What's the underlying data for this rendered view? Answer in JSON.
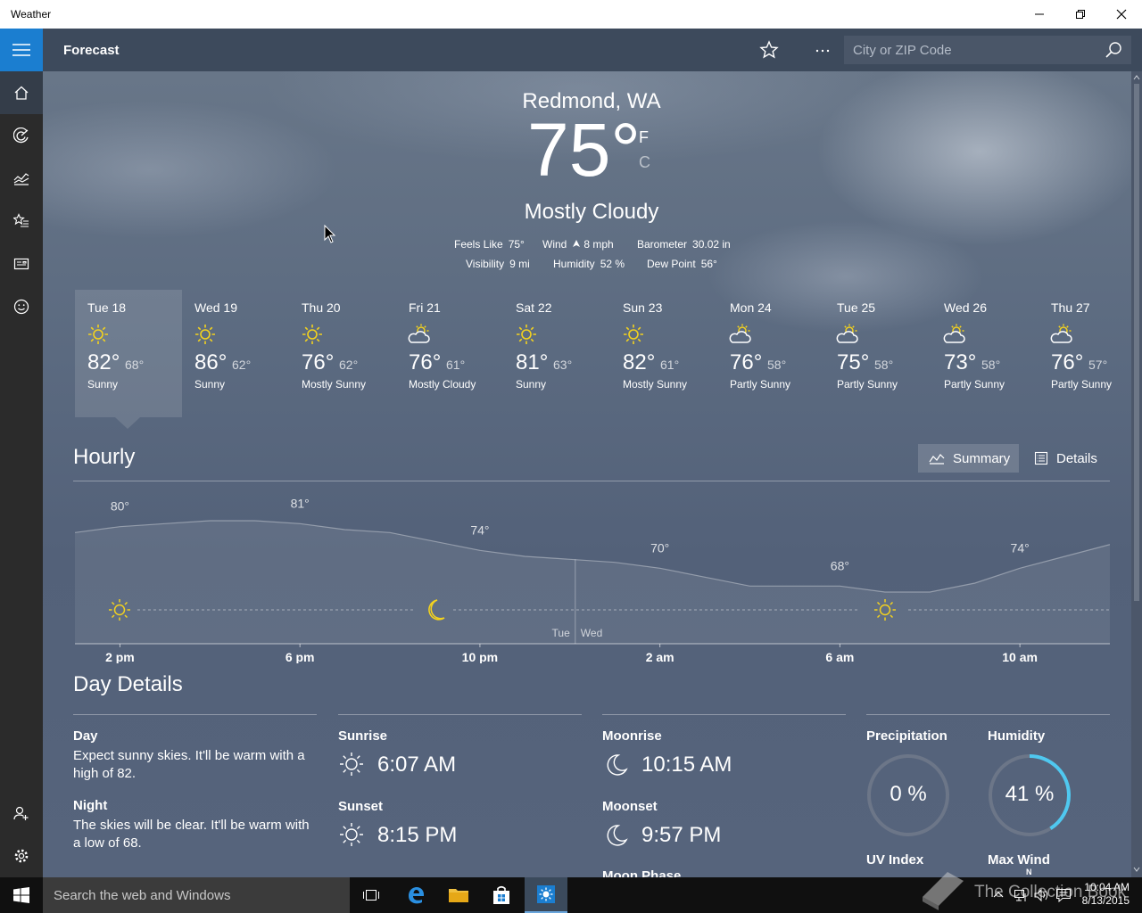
{
  "window": {
    "title": "Weather"
  },
  "appbar": {
    "title": "Forecast",
    "search_placeholder": "City or ZIP Code"
  },
  "current": {
    "location": "Redmond, WA",
    "temp": "75°",
    "unit_f": "F",
    "unit_c": "C",
    "condition": "Mostly Cloudy",
    "details": [
      {
        "label": "Feels Like",
        "value": "75°"
      },
      {
        "label": "Wind",
        "value": "8 mph"
      },
      {
        "label": "Barometer",
        "value": "30.02 in"
      },
      {
        "label": "Visibility",
        "value": "9 mi"
      },
      {
        "label": "Humidity",
        "value": "52 %"
      },
      {
        "label": "Dew Point",
        "value": "56°"
      }
    ]
  },
  "daily": [
    {
      "day": "Tue 18",
      "hi": "82°",
      "lo": "68°",
      "cond": "Sunny",
      "icon": "sun-icon"
    },
    {
      "day": "Wed 19",
      "hi": "86°",
      "lo": "62°",
      "cond": "Sunny",
      "icon": "sun-icon"
    },
    {
      "day": "Thu 20",
      "hi": "76°",
      "lo": "62°",
      "cond": "Mostly Sunny",
      "icon": "sun-icon"
    },
    {
      "day": "Fri 21",
      "hi": "76°",
      "lo": "61°",
      "cond": "Mostly Cloudy",
      "icon": "partly-cloudy-icon"
    },
    {
      "day": "Sat 22",
      "hi": "81°",
      "lo": "63°",
      "cond": "Sunny",
      "icon": "sun-icon"
    },
    {
      "day": "Sun 23",
      "hi": "82°",
      "lo": "61°",
      "cond": "Mostly Sunny",
      "icon": "sun-icon"
    },
    {
      "day": "Mon 24",
      "hi": "76°",
      "lo": "58°",
      "cond": "Partly Sunny",
      "icon": "partly-cloudy-icon"
    },
    {
      "day": "Tue 25",
      "hi": "75°",
      "lo": "58°",
      "cond": "Partly Sunny",
      "icon": "partly-cloudy-icon"
    },
    {
      "day": "Wed 26",
      "hi": "73°",
      "lo": "58°",
      "cond": "Partly Sunny",
      "icon": "partly-cloudy-icon"
    },
    {
      "day": "Thu 27",
      "hi": "76°",
      "lo": "57°",
      "cond": "Partly Sunny",
      "icon": "partly-cloudy-icon"
    }
  ],
  "hourly": {
    "title": "Hourly",
    "summary_label": "Summary",
    "details_label": "Details",
    "time_labels": [
      "2 pm",
      "6 pm",
      "10 pm",
      "2 am",
      "6 am",
      "10 am"
    ],
    "day_divider": {
      "left": "Tue",
      "right": "Wed"
    },
    "temp_labels": [
      "80°",
      "81°",
      "74°",
      "70°",
      "68°",
      "74°"
    ]
  },
  "chart_data": {
    "type": "area",
    "title": "Hourly",
    "x": [
      "1 pm",
      "2 pm",
      "3 pm",
      "4 pm",
      "5 pm",
      "6 pm",
      "7 pm",
      "8 pm",
      "9 pm",
      "10 pm",
      "11 pm",
      "12 am",
      "1 am",
      "2 am",
      "3 am",
      "4 am",
      "5 am",
      "6 am",
      "7 am",
      "8 am",
      "9 am",
      "10 am",
      "11 am",
      "12 pm"
    ],
    "y": [
      79,
      80,
      80.5,
      81,
      81,
      80.5,
      79.5,
      79,
      77.5,
      76,
      75,
      74.5,
      74,
      73,
      71.5,
      70,
      70,
      70,
      69,
      69,
      70.5,
      73,
      75,
      77
    ],
    "labeled_points": {
      "2 pm": 80,
      "6 pm": 81,
      "10 pm": 74,
      "2 am": 70,
      "6 am": 68,
      "10 am": 74
    },
    "xlabel": "",
    "ylabel": ""
  },
  "day_details": {
    "title": "Day Details",
    "day_label": "Day",
    "day_text": "Expect sunny skies. It'll be warm with a high of 82.",
    "night_label": "Night",
    "night_text": "The skies will be clear. It'll be warm with a low of 68.",
    "sunrise_label": "Sunrise",
    "sunrise": "6:07 AM",
    "sunset_label": "Sunset",
    "sunset": "8:15 PM",
    "moonrise_label": "Moonrise",
    "moonrise": "10:15 AM",
    "moonset_label": "Moonset",
    "moonset": "9:57 PM",
    "moonphase_label": "Moon Phase",
    "precip_label": "Precipitation",
    "precip": "0 %",
    "precip_fraction": 0,
    "humidity_label": "Humidity",
    "humidity": "41 %",
    "humidity_fraction": 0.41,
    "uv_label": "UV Index",
    "maxwind_label": "Max Wind",
    "compass_n": "N"
  },
  "taskbar": {
    "search_placeholder": "Search the web and Windows",
    "time": "10:04 AM",
    "date": "8/13/2015",
    "watermark": "The Collection Book"
  },
  "colors": {
    "accent": "#1b7ed0",
    "sun": "#f3d21e",
    "humidity_ring": "#4fc8f0",
    "appbar": "#3d4a5c"
  }
}
